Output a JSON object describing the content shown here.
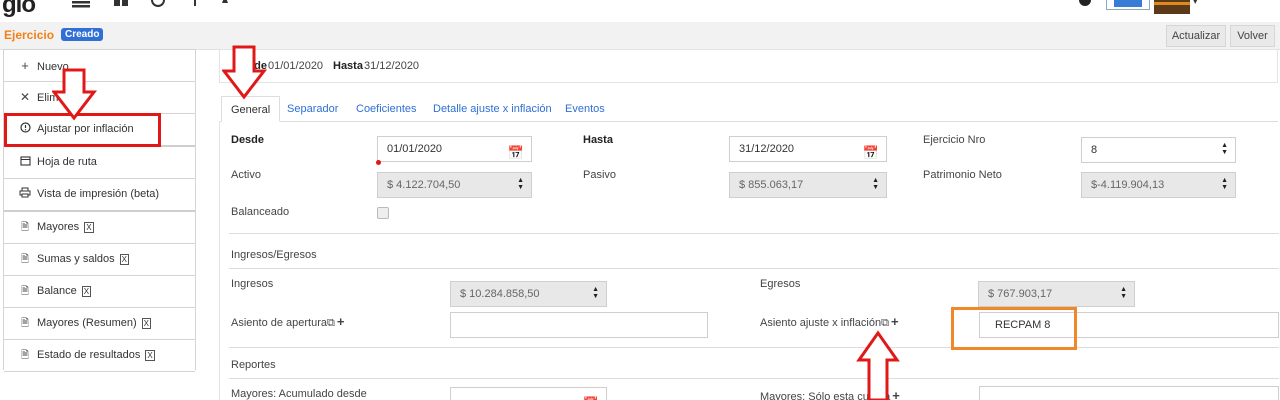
{
  "app": {
    "logo_text": "gio",
    "top_icons": [
      "menu-icon",
      "grid-icon",
      "globe-icon",
      "pin-icon",
      "star-icon"
    ]
  },
  "header": {
    "title": "Ejercicio",
    "status_badge": "Creado",
    "actualizar_label": "Actualizar",
    "volver_label": "Volver"
  },
  "menu": {
    "items": [
      {
        "label": "Nuevo",
        "icon": "plus-icon"
      },
      {
        "label": "Eliminar",
        "icon": "x-icon"
      },
      {
        "label": "Ajustar por inflación",
        "icon": "alert-circle-icon"
      },
      {
        "label": "Hoja de ruta",
        "icon": "calendar-icon"
      },
      {
        "label": "Vista de impresión (beta)",
        "icon": "printer-icon"
      },
      {
        "label": "Mayores",
        "icon": "pdf-icon"
      },
      {
        "label": "Sumas y saldos",
        "icon": "pdf-icon"
      },
      {
        "label": "Balance",
        "icon": "pdf-icon"
      },
      {
        "label": "Mayores (Resumen)",
        "icon": "pdf-icon"
      },
      {
        "label": "Estado de resultados",
        "icon": "pdf-icon"
      }
    ]
  },
  "summary": {
    "desde_label": "Desde",
    "desde_value": "01/01/2020",
    "hasta_label": "Hasta",
    "hasta_value": "31/12/2020"
  },
  "tabs": [
    "General",
    "Separador",
    "Coeficientes",
    "Detalle ajuste x inflación",
    "Eventos"
  ],
  "form": {
    "desde_label": "Desde",
    "desde_value": "01/01/2020",
    "hasta_label": "Hasta",
    "hasta_value": "31/12/2020",
    "ejercicio_nro_label": "Ejercicio Nro",
    "ejercicio_nro_value": "8",
    "activo_label": "Activo",
    "activo_value": "$ 4.122.704,50",
    "pasivo_label": "Pasivo",
    "pasivo_value": "$ 855.063,17",
    "patrimonio_label": "Patrimonio Neto",
    "patrimonio_value": "$-4.119.904,13",
    "balanceado_label": "Balanceado",
    "ingresos_egresos_section": "Ingresos/Egresos",
    "ingresos_label": "Ingresos",
    "ingresos_value": "$ 10.284.858,50",
    "egresos_label": "Egresos",
    "egresos_value": "$ 767.903,17",
    "asiento_apertura_label": "Asiento de apertura",
    "asiento_apertura_value": "",
    "asiento_ajuste_label": "Asiento ajuste x inflación",
    "asiento_ajuste_value": "RECPAM 8",
    "reportes_section": "Reportes",
    "mayores_acumulado_label": "Mayores: Acumulado desde",
    "mayores_solo_label": "Mayores: Sólo esta cuenta"
  },
  "colors": {
    "accent_orange": "#f57f17",
    "badge_blue": "#2f6fd6",
    "annotation_red": "#e01818",
    "annotation_orange": "#f0882a"
  }
}
